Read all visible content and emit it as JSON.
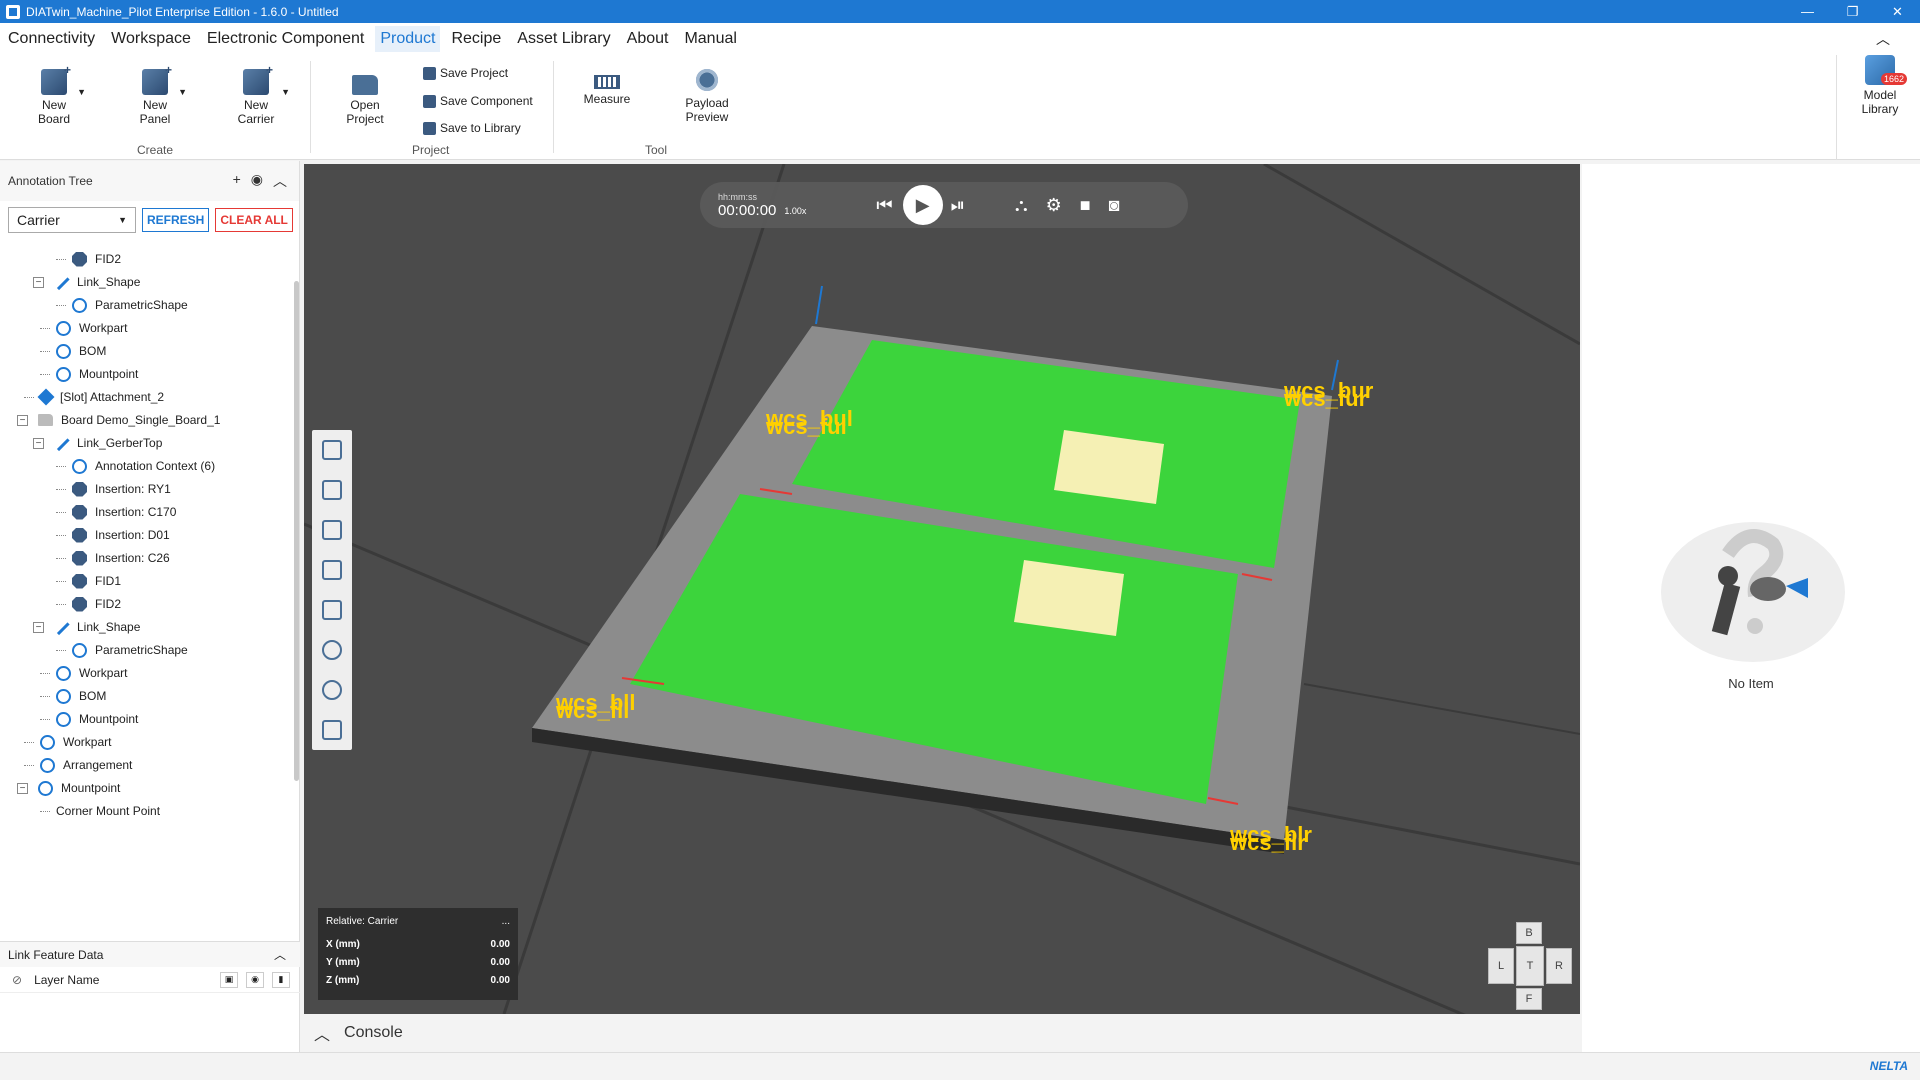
{
  "window": {
    "title": "DIATwin_Machine_Pilot Enterprise Edition - 1.6.0 - Untitled",
    "controls": [
      "—",
      "❐",
      "✕"
    ]
  },
  "menu": {
    "items": [
      "Connectivity",
      "Workspace",
      "Electronic Component",
      "Product",
      "Recipe",
      "Asset Library",
      "About",
      "Manual"
    ],
    "active": "Product"
  },
  "ribbon": {
    "create": {
      "label": "Create",
      "new_board": "New\nBoard",
      "new_panel": "New\nPanel",
      "new_carrier": "New\nCarrier"
    },
    "project": {
      "label": "Project",
      "open_project": "Open\nProject",
      "save_project": "Save Project",
      "save_component": "Save Component",
      "save_to_library": "Save to Library"
    },
    "tool": {
      "label": "Tool",
      "measure": "Measure",
      "payload_preview": "Payload\nPreview"
    },
    "model_library": "Model\nLibrary",
    "model_library_badge": "1662"
  },
  "annotation_tree": {
    "title": "Annotation Tree",
    "selector_value": "Carrier",
    "refresh_label": "REFRESH",
    "clear_all_label": "CLEAR ALL",
    "items": [
      {
        "label": "FID2",
        "icon": "component-icon"
      },
      {
        "label": "Link_Shape",
        "icon": "link-icon"
      },
      {
        "label": "ParametricShape",
        "icon": "gear-icon"
      },
      {
        "label": "Workpart",
        "icon": "gear-icon"
      },
      {
        "label": "BOM",
        "icon": "gear-icon"
      },
      {
        "label": "Mountpoint",
        "icon": "gear-icon"
      },
      {
        "label": "[Slot] Attachment_2",
        "icon": "slot-icon"
      },
      {
        "label": "Board  Demo_Single_Board_1",
        "icon": "folder-icon"
      },
      {
        "label": "Link_GerberTop",
        "icon": "link-icon"
      },
      {
        "label": "Annotation Context (6)",
        "icon": "gear-icon"
      },
      {
        "label": "Insertion: RY1",
        "icon": "component-icon"
      },
      {
        "label": "Insertion: C170",
        "icon": "component-icon"
      },
      {
        "label": "Insertion: D01",
        "icon": "component-icon"
      },
      {
        "label": "Insertion: C26",
        "icon": "component-icon"
      },
      {
        "label": "FID1",
        "icon": "component-icon"
      },
      {
        "label": "FID2",
        "icon": "component-icon"
      },
      {
        "label": "Link_Shape",
        "icon": "link-icon"
      },
      {
        "label": "ParametricShape",
        "icon": "gear-icon"
      },
      {
        "label": "Workpart",
        "icon": "gear-icon"
      },
      {
        "label": "BOM",
        "icon": "gear-icon"
      },
      {
        "label": "Mountpoint",
        "icon": "gear-icon"
      },
      {
        "label": "Workpart",
        "icon": "gear-icon"
      },
      {
        "label": "Arrangement",
        "icon": "gear-icon"
      },
      {
        "label": "Mountpoint",
        "icon": "gear-icon"
      },
      {
        "label": "Corner Mount Point",
        "icon": "none"
      }
    ]
  },
  "link_feature": {
    "title": "Link Feature Data",
    "column": "Layer Name"
  },
  "viewport": {
    "time_label": "hh:mm:ss",
    "time_value": "00:00:00",
    "speed": "1.00x",
    "coord": {
      "relative": "Relative: Carrier",
      "more": "...",
      "x_label": "X (mm)",
      "x_value": "0.00",
      "y_label": "Y (mm)",
      "y_value": "0.00",
      "z_label": "Z (mm)",
      "z_value": "0.00"
    },
    "navcube": {
      "top": "B",
      "left": "L",
      "center": "T",
      "right": "R",
      "bottom": "F"
    },
    "wcs_labels": {
      "ul_1": "wcs_bul",
      "ul_2": "wcs_ful",
      "ur_1": "wcs_bur",
      "ur_2": "wcs_fur",
      "ll_1": "wcs_bll",
      "ll_2": "wcs_fll",
      "lr_1": "wcs_blr",
      "lr_2": "wcs_flr"
    }
  },
  "console": {
    "label": "Console"
  },
  "right_panel": {
    "empty_text": "No Item"
  },
  "status": {
    "brand": "NELTA"
  }
}
